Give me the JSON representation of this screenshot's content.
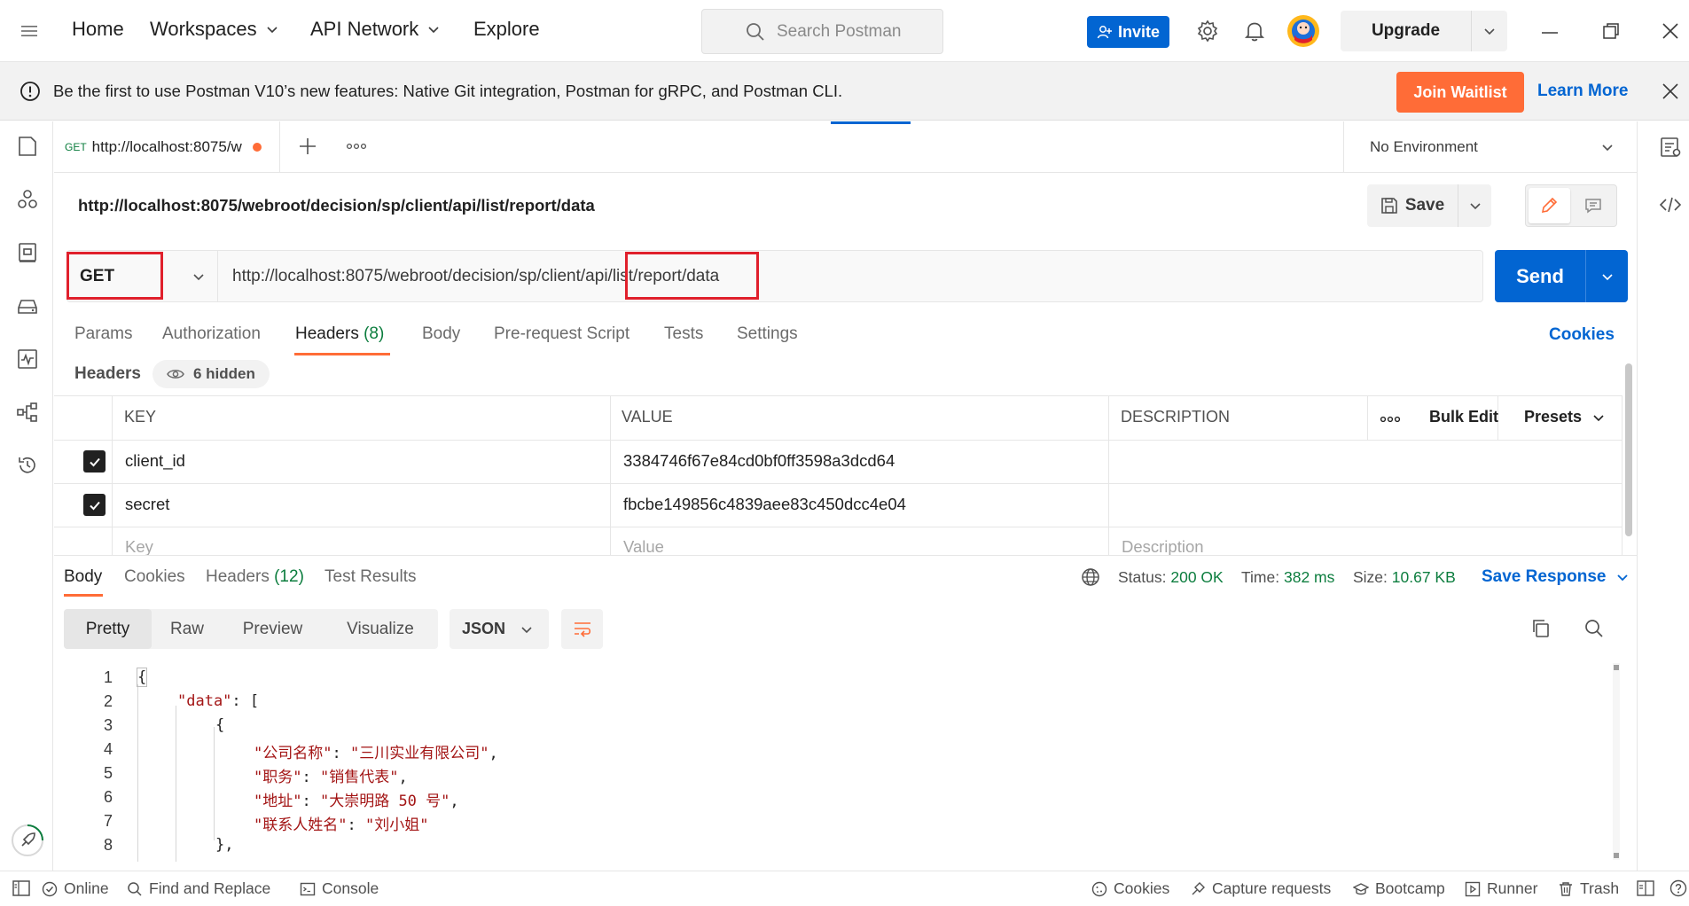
{
  "nav": {
    "home": "Home",
    "workspaces": "Workspaces",
    "api_network": "API Network",
    "explore": "Explore",
    "search_placeholder": "Search Postman",
    "invite": "Invite",
    "upgrade": "Upgrade"
  },
  "banner": {
    "message": "Be the first to use Postman V10’s new features: Native Git integration, Postman for gRPC, and Postman CLI.",
    "join": "Join Waitlist",
    "learn_more": "Learn More"
  },
  "tab": {
    "method": "GET",
    "title": "http://localhost:8075/w"
  },
  "environment": "No Environment",
  "request": {
    "title": "http://localhost:8075/webroot/decision/sp/client/api/list/report/data",
    "method": "GET",
    "url": "http://localhost:8075/webroot/decision/sp/client/api/list/report/data",
    "save": "Save",
    "send": "Send",
    "tabs": {
      "params": "Params",
      "authorization": "Authorization",
      "headers": "Headers",
      "headers_count": "(8)",
      "body": "Body",
      "prerequest": "Pre-request Script",
      "tests": "Tests",
      "settings": "Settings"
    },
    "cookies": "Cookies",
    "headers_label": "Headers",
    "hidden": "6 hidden"
  },
  "table": {
    "col_key": "KEY",
    "col_value": "VALUE",
    "col_description": "DESCRIPTION",
    "bulk_edit": "Bulk Edit",
    "presets": "Presets",
    "rows": [
      {
        "key": "client_id",
        "value": "3384746f67e84cd0bf0ff3598a3dcd64",
        "checked": true
      },
      {
        "key": "secret",
        "value": "fbcbe149856c4839aee83c450dcc4e04",
        "checked": true
      }
    ],
    "placeholder_key": "Key",
    "placeholder_value": "Value",
    "placeholder_description": "Description"
  },
  "response": {
    "tabs": {
      "body": "Body",
      "cookies": "Cookies",
      "headers": "Headers",
      "headers_count": "(12)",
      "test_results": "Test Results"
    },
    "status_label": "Status:",
    "status_value": "200 OK",
    "time_label": "Time:",
    "time_value": "382 ms",
    "size_label": "Size:",
    "size_value": "10.67 KB",
    "save_response": "Save Response",
    "views": {
      "pretty": "Pretty",
      "raw": "Raw",
      "preview": "Preview",
      "visualize": "Visualize"
    },
    "format": "JSON",
    "code_lines": [
      {
        "n": "1",
        "text": "{"
      },
      {
        "n": "2",
        "key": "\"data\"",
        "rest": ": ["
      },
      {
        "n": "3",
        "text": "{"
      },
      {
        "n": "4",
        "key": "\"公司名称\"",
        "sep": ": ",
        "val": "\"三川实业有限公司\"",
        "end": ","
      },
      {
        "n": "5",
        "key": "\"职务\"",
        "sep": ": ",
        "val": "\"销售代表\"",
        "end": ","
      },
      {
        "n": "6",
        "key": "\"地址\"",
        "sep": ": ",
        "val": "\"大崇明路 50 号\"",
        "end": ","
      },
      {
        "n": "7",
        "key": "\"联系人姓名\"",
        "sep": ": ",
        "val": "\"刘小姐\"",
        "end": ""
      },
      {
        "n": "8",
        "text": "},"
      }
    ]
  },
  "statusbar": {
    "online": "Online",
    "find_replace": "Find and Replace",
    "console": "Console",
    "cookies": "Cookies",
    "capture": "Capture requests",
    "bootcamp": "Bootcamp",
    "runner": "Runner",
    "trash": "Trash"
  },
  "colors": {
    "accent": "#ff6c37",
    "primary": "#0265d2",
    "success": "#0c7d3e",
    "highlight": "#e0202c"
  }
}
